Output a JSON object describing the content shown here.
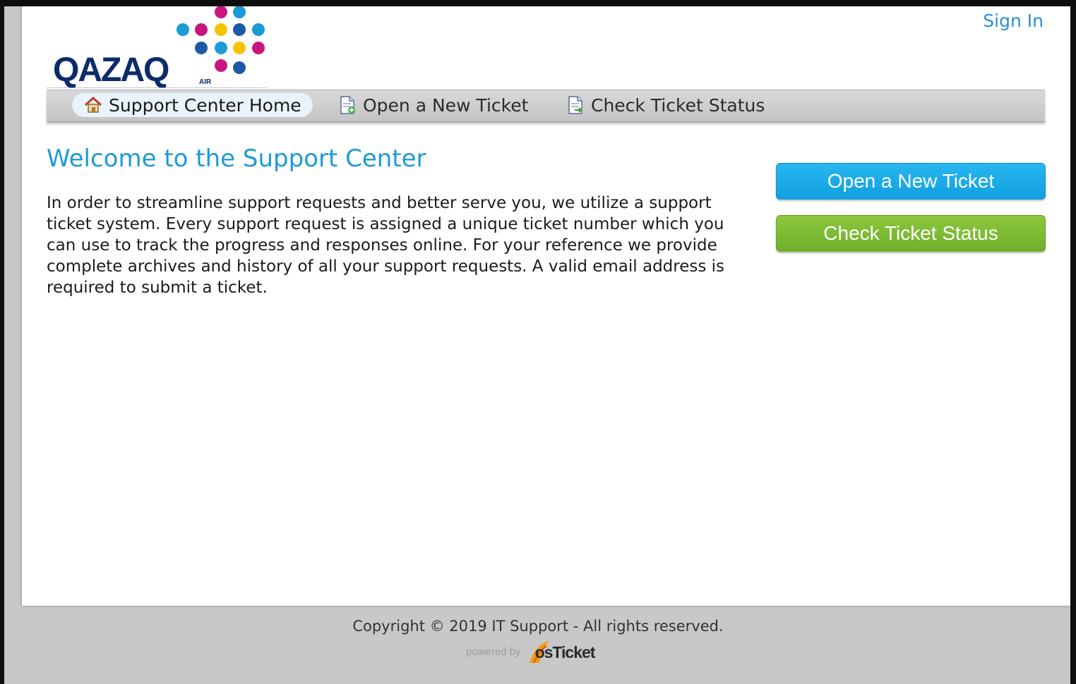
{
  "logo": {
    "brand": "QAZAQ",
    "sub": "AIR",
    "dot_colors": [
      "#c8167d",
      "#1b9bd6",
      "#f5c400",
      "#1c5aa8"
    ]
  },
  "header": {
    "sign_in": "Sign In"
  },
  "nav": {
    "items": [
      {
        "label": "Support Center Home",
        "icon": "home-icon",
        "active": true
      },
      {
        "label": "Open a New Ticket",
        "icon": "new-ticket-icon",
        "active": false
      },
      {
        "label": "Check Ticket Status",
        "icon": "ticket-status-icon",
        "active": false
      }
    ]
  },
  "main": {
    "title": "Welcome to the Support Center",
    "intro": "In order to streamline support requests and better serve you, we utilize a support ticket system. Every support request is assigned a unique ticket number which you can use to track the progress and responses online. For your reference we provide complete archives and history of all your support requests. A valid email address is required to submit a ticket."
  },
  "sidebar": {
    "open_ticket": "Open a New Ticket",
    "check_status": "Check Ticket Status"
  },
  "footer": {
    "copyright": "Copyright © 2019 IT Support - All rights reserved.",
    "powered_by": "powered by",
    "brand": "osTicket"
  },
  "colors": {
    "link": "#2a8ed6",
    "title": "#1e9ad6",
    "btn_blue": "#1aa8e8",
    "btn_green": "#7dbb35"
  }
}
